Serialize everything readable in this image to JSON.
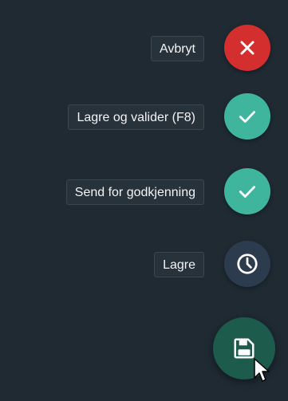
{
  "actions": [
    {
      "label": "Avbryt",
      "icon": "close-icon",
      "color": "#d32f2f"
    },
    {
      "label": "Lagre og valider (F8)",
      "icon": "check-icon",
      "color": "#3fb59e"
    },
    {
      "label": "Send for godkjenning",
      "icon": "check-icon",
      "color": "#3fb59e"
    },
    {
      "label": "Lagre",
      "icon": "clock-icon",
      "color": "#2d3b4e"
    }
  ],
  "main_fab": {
    "icon": "save-icon",
    "color": "#1d5b4c"
  }
}
